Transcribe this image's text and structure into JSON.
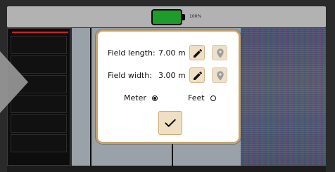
{
  "status": {
    "battery_percent_text": "100%",
    "battery_level": 1.0
  },
  "dialog": {
    "field_length_label": "Field length:",
    "field_length_value": "7.00 m",
    "field_width_label": "Field width:",
    "field_width_value": "3.00 m",
    "unit_options": [
      {
        "label": "Meter",
        "selected": true
      },
      {
        "label": "Feet",
        "selected": false
      }
    ]
  },
  "icons": {
    "edit": "pencil-icon",
    "location": "location-pin-icon",
    "confirm": "checkmark-icon",
    "battery": "battery-icon",
    "back": "chevron-left-icon"
  },
  "colors": {
    "dialog_border": "#c8a46b",
    "button_bg": "#f0dfc3",
    "battery_fill": "#1f9b2c"
  }
}
